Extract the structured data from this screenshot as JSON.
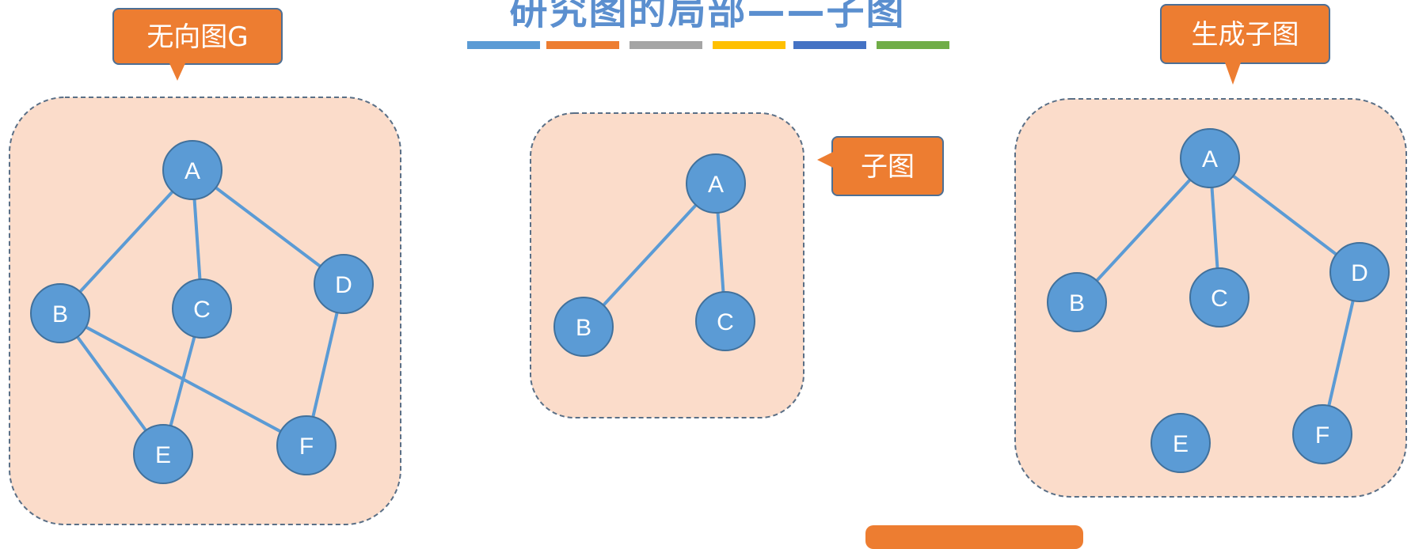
{
  "header": {
    "title": "研究图的局部——子图",
    "stripe_colors": [
      "#5b9bd5",
      "#ed7d31",
      "#a5a5a5",
      "#ffc000",
      "#4472c4",
      "#70ad47"
    ]
  },
  "callouts": {
    "graph_g": "无向图G",
    "subgraph": "子图",
    "spanning_subgraph": "生成子图"
  },
  "colors": {
    "node_fill": "#5b9bd5",
    "node_stroke": "#41719c",
    "edge": "#5b9bd5",
    "panel_fill": "#fbdcca",
    "panel_border": "#5a6f86",
    "callout_fill": "#ed7d31"
  },
  "diagram": {
    "graphs": [
      {
        "name": "undirected-graph-g",
        "nodes": [
          "A",
          "B",
          "C",
          "D",
          "E",
          "F"
        ],
        "edges": [
          [
            "A",
            "B"
          ],
          [
            "A",
            "C"
          ],
          [
            "A",
            "D"
          ],
          [
            "B",
            "E"
          ],
          [
            "B",
            "F"
          ],
          [
            "C",
            "E"
          ],
          [
            "D",
            "F"
          ]
        ]
      },
      {
        "name": "subgraph",
        "nodes": [
          "A",
          "B",
          "C"
        ],
        "edges": [
          [
            "A",
            "B"
          ],
          [
            "A",
            "C"
          ]
        ]
      },
      {
        "name": "spanning-subgraph",
        "nodes": [
          "A",
          "B",
          "C",
          "D",
          "E",
          "F"
        ],
        "edges": [
          [
            "A",
            "B"
          ],
          [
            "A",
            "C"
          ],
          [
            "A",
            "D"
          ],
          [
            "D",
            "F"
          ]
        ]
      }
    ]
  }
}
